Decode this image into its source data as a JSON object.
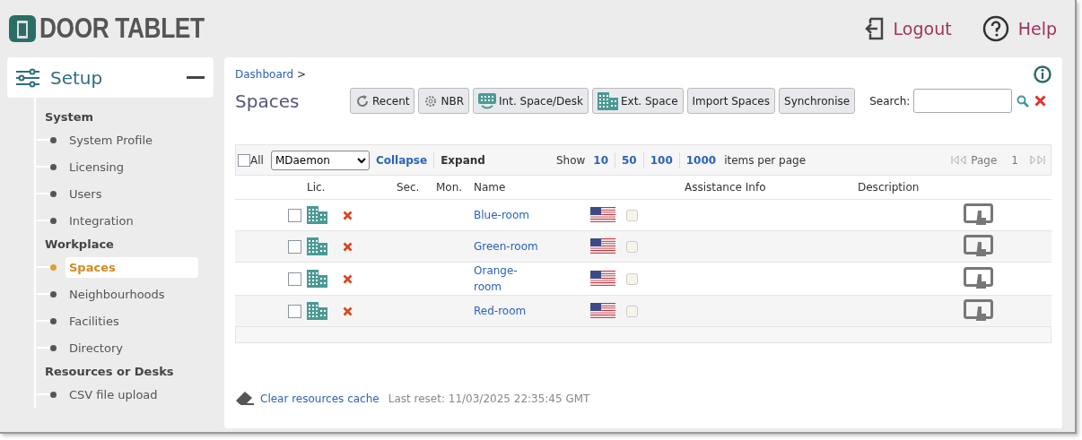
{
  "header": {
    "logo": "DOOR TABLET",
    "links": [
      {
        "kind": "logout",
        "label": "Logout"
      },
      {
        "kind": "help",
        "label": "Help"
      }
    ]
  },
  "sidebar": {
    "title": "Setup",
    "expanded": true,
    "groups": [
      {
        "heading": "System",
        "items": [
          {
            "label": "System Profile",
            "selected": false
          },
          {
            "label": "Licensing",
            "selected": false
          },
          {
            "label": "Users",
            "selected": false
          },
          {
            "label": "Integration",
            "selected": false
          }
        ]
      },
      {
        "heading": "Workplace",
        "items": [
          {
            "label": "Spaces",
            "selected": true
          },
          {
            "label": "Neighbourhoods",
            "selected": false
          },
          {
            "label": "Facilities",
            "selected": false
          },
          {
            "label": "Directory",
            "selected": false
          }
        ]
      },
      {
        "heading": "Resources or Desks",
        "items": [
          {
            "label": "CSV file upload",
            "selected": false
          }
        ]
      }
    ]
  },
  "breadcrumb": [
    "Dashboard",
    ">"
  ],
  "page_title": "Spaces",
  "toolbar": [
    {
      "kind": "refresh",
      "label": "Recent"
    },
    {
      "kind": "gear",
      "label": "NBR"
    },
    {
      "kind": "desk",
      "label": "Int. Space/Desk"
    },
    {
      "kind": "building",
      "label": "Ext. Space"
    },
    {
      "kind": "plain",
      "label": "Import Spaces"
    },
    {
      "kind": "plain",
      "label": "Synchronise"
    }
  ],
  "search": {
    "label": "Search:"
  },
  "list_bar": {
    "all_label": "All",
    "all_checked": false,
    "select_value": "MDaemon",
    "collapse": "Collapse",
    "expand": "Expand",
    "show_label": "Show",
    "page_sizes": [
      "10",
      "50",
      "100",
      "1000"
    ],
    "per_page_label": "items per page",
    "page_label": "Page",
    "page": "1"
  },
  "table": {
    "columns": [
      "Lic.",
      "Sec.",
      "Mon.",
      "Name",
      "Assistance Info",
      "Description"
    ],
    "rows": [
      {
        "checked": false,
        "name": "Blue-room",
        "flag_checked": false
      },
      {
        "checked": false,
        "name": "Green-room",
        "flag_checked": false
      },
      {
        "checked": false,
        "name": "Orange-room",
        "flag_checked": false
      },
      {
        "checked": false,
        "name": "Red-room",
        "flag_checked": false
      }
    ]
  },
  "footer": {
    "link": "Clear resources cache",
    "note": "Last reset: 11/03/2025 22:35:45 GMT"
  }
}
